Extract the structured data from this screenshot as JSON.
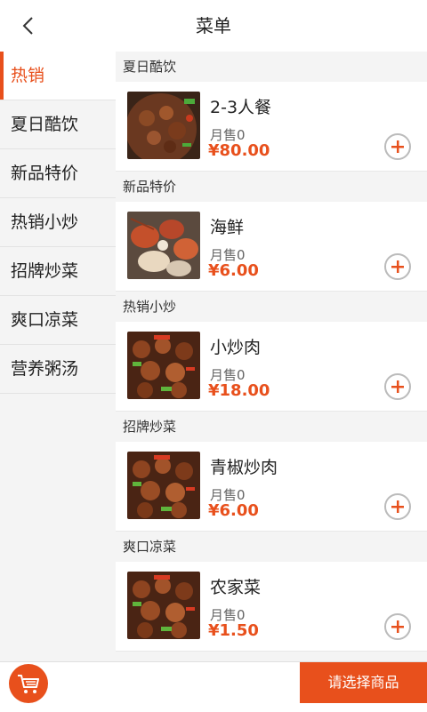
{
  "header": {
    "title": "菜单"
  },
  "sidebar": {
    "items": [
      {
        "label": "热销"
      },
      {
        "label": "夏日酷饮"
      },
      {
        "label": "新品特价"
      },
      {
        "label": "热销小炒"
      },
      {
        "label": "招牌炒菜"
      },
      {
        "label": "爽口凉菜"
      },
      {
        "label": "营养粥汤"
      }
    ]
  },
  "sections": [
    {
      "title": "夏日酷饮",
      "item": {
        "name": "2-3人餐",
        "sold": "月售0",
        "price": "¥80.00"
      }
    },
    {
      "title": "新品特价",
      "item": {
        "name": "海鲜",
        "sold": "月售0",
        "price": "¥6.00"
      }
    },
    {
      "title": "热销小炒",
      "item": {
        "name": "小炒肉",
        "sold": "月售0",
        "price": "¥18.00"
      }
    },
    {
      "title": "招牌炒菜",
      "item": {
        "name": "青椒炒肉",
        "sold": "月售0",
        "price": "¥6.00"
      }
    },
    {
      "title": "爽口凉菜",
      "item": {
        "name": "农家菜",
        "sold": "月售0",
        "price": "¥1.50"
      }
    }
  ],
  "footer": {
    "checkout_label": "请选择商品"
  },
  "colors": {
    "accent": "#e8501c",
    "background": "#f4f4f4"
  }
}
